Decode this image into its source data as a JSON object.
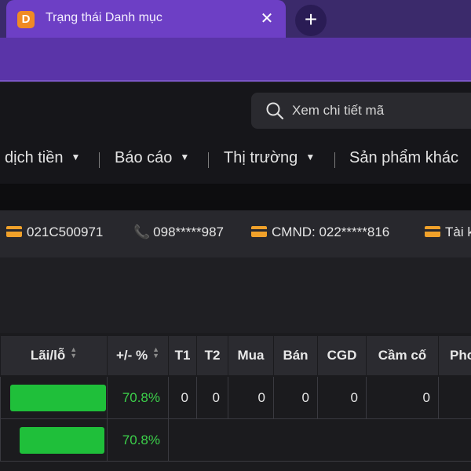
{
  "browser": {
    "tab_title": "Trạng thái Danh mục",
    "favicon_letter": "D",
    "close_label": "✕",
    "new_tab_label": "+"
  },
  "search": {
    "placeholder": "Xem chi tiết mã"
  },
  "nav": {
    "items": [
      {
        "label": "dịch tiền"
      },
      {
        "label": "Báo cáo"
      },
      {
        "label": "Thị trường"
      },
      {
        "label": "Sản phẩm khác"
      }
    ]
  },
  "info": {
    "account": "021C500971",
    "phone": "098*****987",
    "id": "CMND: 022*****816",
    "extra": "Tài k"
  },
  "table": {
    "headers": [
      "Lãi/lỗ",
      "+/- %",
      "T1",
      "T2",
      "Mua",
      "Bán",
      "CGD",
      "Cầm cố",
      "Phon"
    ],
    "rows": [
      {
        "pct": "70.8%",
        "t1": "0",
        "t2": "0",
        "mua": "0",
        "ban": "0",
        "cgd": "0",
        "camco": "0"
      },
      {
        "pct": "70.8%"
      }
    ]
  },
  "colors": {
    "tab_active": "#6d3fc5",
    "accent_orange": "#f0a12a",
    "positive_green": "#3cd04a"
  }
}
